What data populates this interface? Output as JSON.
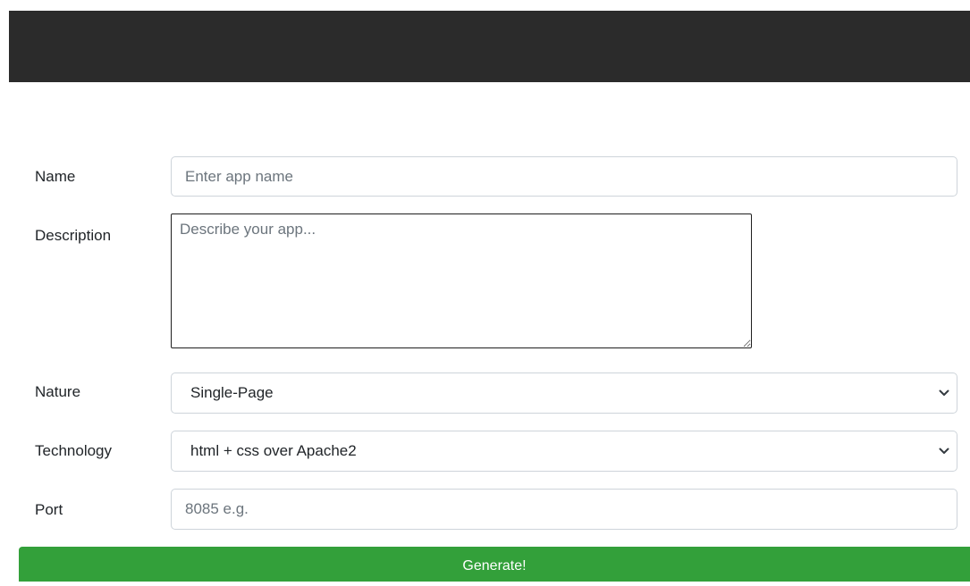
{
  "form": {
    "name": {
      "label": "Name",
      "placeholder": "Enter app name",
      "value": ""
    },
    "description": {
      "label": "Description",
      "placeholder": "Describe your app...",
      "value": ""
    },
    "nature": {
      "label": "Nature",
      "selected": "Single-Page"
    },
    "technology": {
      "label": "Technology",
      "selected": "html + css over Apache2"
    },
    "port": {
      "label": "Port",
      "placeholder": "8085 e.g.",
      "value": ""
    },
    "submit_label": "Generate!"
  },
  "icons": {
    "select_arrow": "chevron-down-icon"
  },
  "colors": {
    "header_bg": "#2b2b2b",
    "button_bg": "#33a03a",
    "button_text": "#ffffff"
  }
}
